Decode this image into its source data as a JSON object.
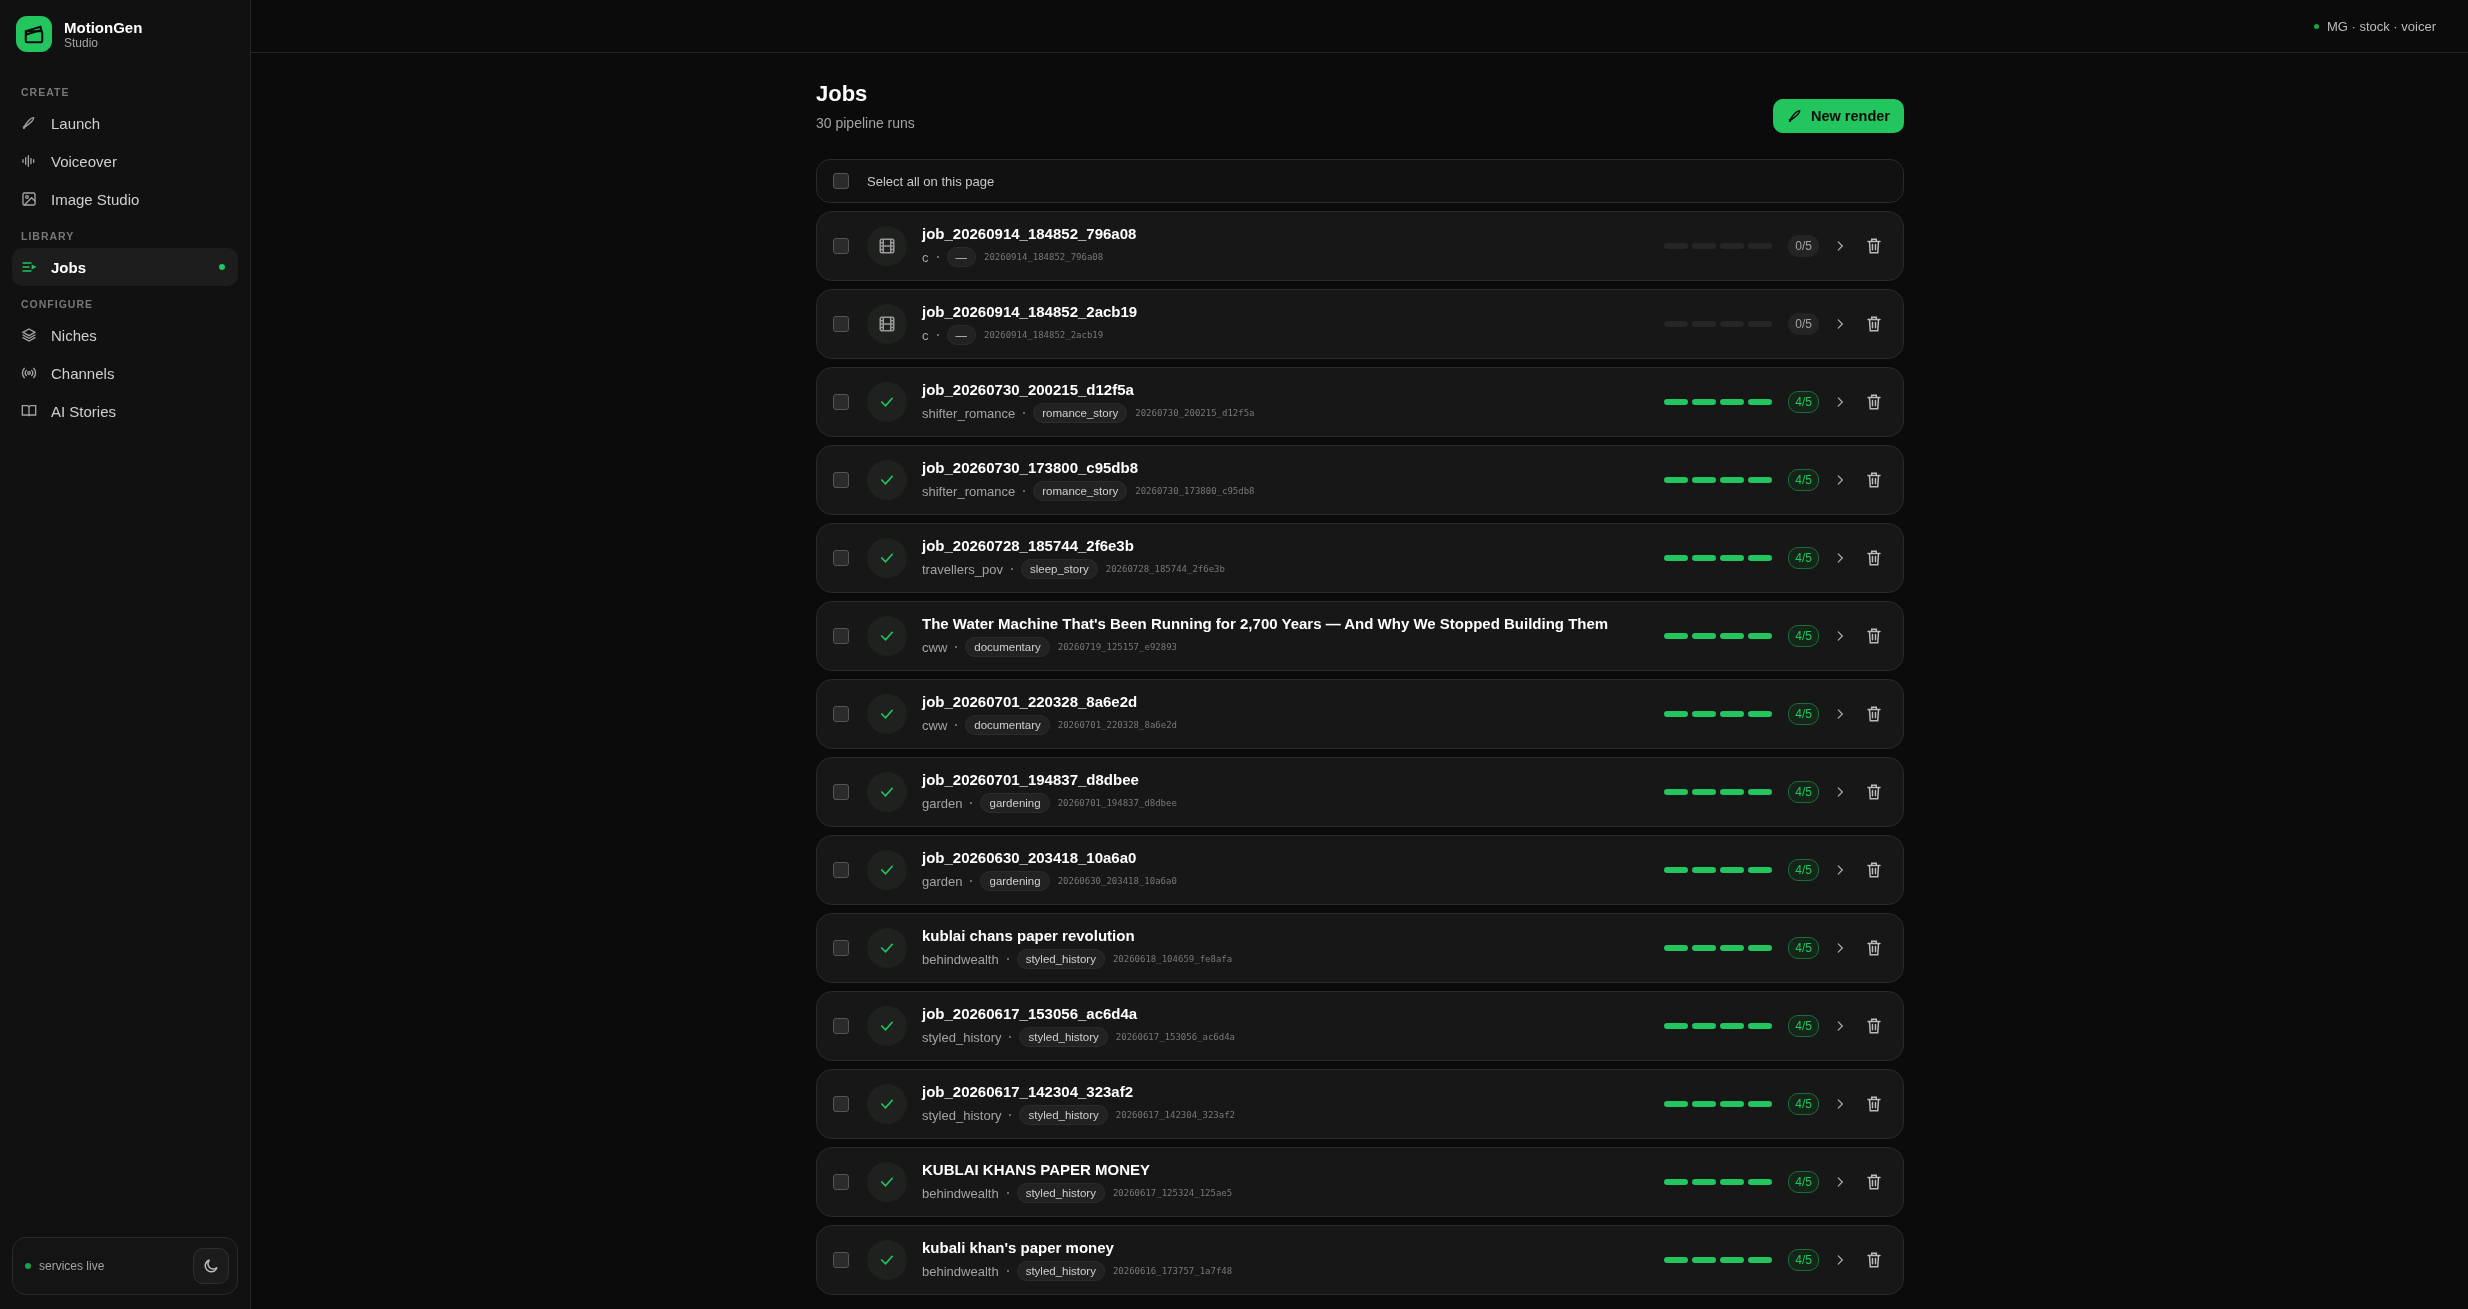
{
  "brand": {
    "name": "MotionGen",
    "subtitle": "Studio"
  },
  "sidebar": {
    "sections": [
      {
        "heading": "CREATE",
        "items": [
          {
            "label": "Launch",
            "selected": false
          },
          {
            "label": "Voiceover",
            "selected": false
          },
          {
            "label": "Image Studio",
            "selected": false
          }
        ]
      },
      {
        "heading": "LIBRARY",
        "items": [
          {
            "label": "Jobs",
            "selected": true
          }
        ]
      },
      {
        "heading": "CONFIGURE",
        "items": [
          {
            "label": "Niches",
            "selected": false
          },
          {
            "label": "Channels",
            "selected": false
          },
          {
            "label": "AI Stories",
            "selected": false
          }
        ]
      }
    ],
    "footer": {
      "status": "services live"
    }
  },
  "header": {
    "status": "MG · stock · voicer"
  },
  "page": {
    "title": "Jobs",
    "subtitle": "30 pipeline runs",
    "new_button": "New render",
    "select_all": {
      "label": "Select all on this page",
      "checked": false
    }
  },
  "jobs": [
    {
      "title": "job_20260914_184852_796a08",
      "channel": "c",
      "niche": "—",
      "run_id": "20260914_184852_796a08",
      "kind": "pending",
      "steps": [
        {
          "on": false
        },
        {
          "on": false
        },
        {
          "on": false
        },
        {
          "on": false
        }
      ],
      "progress": "0/5",
      "checked": false
    },
    {
      "title": "job_20260914_184852_2acb19",
      "channel": "c",
      "niche": "—",
      "run_id": "20260914_184852_2acb19",
      "kind": "pending",
      "steps": [
        {
          "on": false
        },
        {
          "on": false
        },
        {
          "on": false
        },
        {
          "on": false
        }
      ],
      "progress": "0/5",
      "checked": false
    },
    {
      "title": "job_20260730_200215_d12f5a",
      "channel": "shifter_romance",
      "niche": "romance_story",
      "run_id": "20260730_200215_d12f5a",
      "kind": "done",
      "steps": [
        {
          "on": true
        },
        {
          "on": true
        },
        {
          "on": true
        },
        {
          "on": true
        }
      ],
      "progress": "4/5",
      "checked": false
    },
    {
      "title": "job_20260730_173800_c95db8",
      "channel": "shifter_romance",
      "niche": "romance_story",
      "run_id": "20260730_173800_c95db8",
      "kind": "done",
      "steps": [
        {
          "on": true
        },
        {
          "on": true
        },
        {
          "on": true
        },
        {
          "on": true
        }
      ],
      "progress": "4/5",
      "checked": false
    },
    {
      "title": "job_20260728_185744_2f6e3b",
      "channel": "travellers_pov",
      "niche": "sleep_story",
      "run_id": "20260728_185744_2f6e3b",
      "kind": "done",
      "steps": [
        {
          "on": true
        },
        {
          "on": true
        },
        {
          "on": true
        },
        {
          "on": true
        }
      ],
      "progress": "4/5",
      "checked": false
    },
    {
      "title": "The Water Machine That's Been Running for 2,700 Years — And Why We Stopped Building Them",
      "channel": "cww",
      "niche": "documentary",
      "run_id": "20260719_125157_e92893",
      "kind": "done",
      "steps": [
        {
          "on": true
        },
        {
          "on": true
        },
        {
          "on": true
        },
        {
          "on": true
        }
      ],
      "progress": "4/5",
      "checked": false
    },
    {
      "title": "job_20260701_220328_8a6e2d",
      "channel": "cww",
      "niche": "documentary",
      "run_id": "20260701_220328_8a6e2d",
      "kind": "done",
      "steps": [
        {
          "on": true
        },
        {
          "on": true
        },
        {
          "on": true
        },
        {
          "on": true
        }
      ],
      "progress": "4/5",
      "checked": false
    },
    {
      "title": "job_20260701_194837_d8dbee",
      "channel": "garden",
      "niche": "gardening",
      "run_id": "20260701_194837_d8dbee",
      "kind": "done",
      "steps": [
        {
          "on": true
        },
        {
          "on": true
        },
        {
          "on": true
        },
        {
          "on": true
        }
      ],
      "progress": "4/5",
      "checked": false
    },
    {
      "title": "job_20260630_203418_10a6a0",
      "channel": "garden",
      "niche": "gardening",
      "run_id": "20260630_203418_10a6a0",
      "kind": "done",
      "steps": [
        {
          "on": true
        },
        {
          "on": true
        },
        {
          "on": true
        },
        {
          "on": true
        }
      ],
      "progress": "4/5",
      "checked": false
    },
    {
      "title": "kublai chans paper revolution",
      "channel": "behindwealth",
      "niche": "styled_history",
      "run_id": "20260618_104659_fe8afa",
      "kind": "done",
      "steps": [
        {
          "on": true
        },
        {
          "on": true
        },
        {
          "on": true
        },
        {
          "on": true
        }
      ],
      "progress": "4/5",
      "checked": false
    },
    {
      "title": "job_20260617_153056_ac6d4a",
      "channel": "styled_history",
      "niche": "styled_history",
      "run_id": "20260617_153056_ac6d4a",
      "kind": "done",
      "steps": [
        {
          "on": true
        },
        {
          "on": true
        },
        {
          "on": true
        },
        {
          "on": true
        }
      ],
      "progress": "4/5",
      "checked": false
    },
    {
      "title": "job_20260617_142304_323af2",
      "channel": "styled_history",
      "niche": "styled_history",
      "run_id": "20260617_142304_323af2",
      "kind": "done",
      "steps": [
        {
          "on": true
        },
        {
          "on": true
        },
        {
          "on": true
        },
        {
          "on": true
        }
      ],
      "progress": "4/5",
      "checked": false
    },
    {
      "title": "KUBLAI KHANS PAPER MONEY",
      "channel": "behindwealth",
      "niche": "styled_history",
      "run_id": "20260617_125324_125ae5",
      "kind": "done",
      "steps": [
        {
          "on": true
        },
        {
          "on": true
        },
        {
          "on": true
        },
        {
          "on": true
        }
      ],
      "progress": "4/5",
      "checked": false
    },
    {
      "title": "kubali khan's paper money",
      "channel": "behindwealth",
      "niche": "styled_history",
      "run_id": "20260616_173757_1a7f48",
      "kind": "done",
      "steps": [
        {
          "on": true
        },
        {
          "on": true
        },
        {
          "on": true
        },
        {
          "on": true
        }
      ],
      "progress": "4/5",
      "checked": false
    }
  ]
}
